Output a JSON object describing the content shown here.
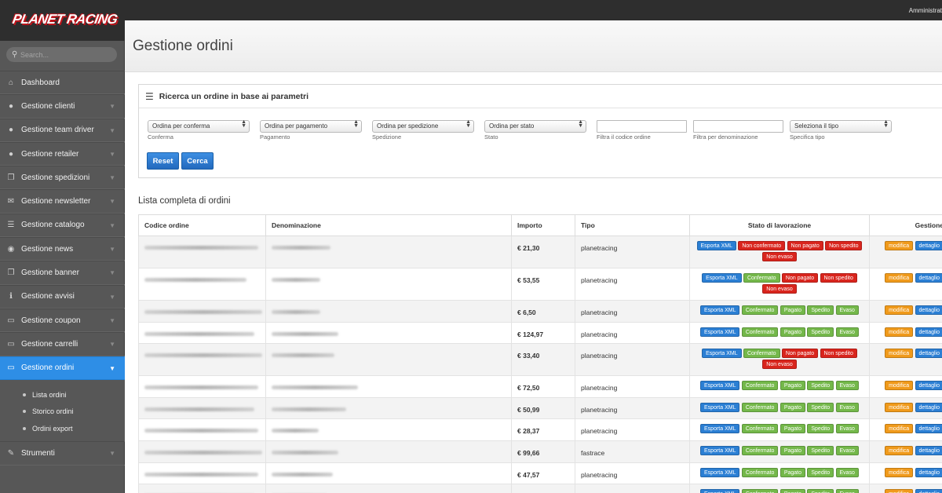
{
  "header": {
    "user_label": "Amministrat"
  },
  "sidebar": {
    "logo_text": "PLANET RACING",
    "search_placeholder": "Search...",
    "items": [
      {
        "label": "Dashboard",
        "icon": "home-icon",
        "glyph": "⌂",
        "has_children": false
      },
      {
        "label": "Gestione clienti",
        "icon": "user-icon",
        "glyph": "●",
        "has_children": true
      },
      {
        "label": "Gestione team driver",
        "icon": "user-icon",
        "glyph": "●",
        "has_children": true
      },
      {
        "label": "Gestione retailer",
        "icon": "user-icon",
        "glyph": "●",
        "has_children": true
      },
      {
        "label": "Gestione spedizioni",
        "icon": "copy-icon",
        "glyph": "❐",
        "has_children": true
      },
      {
        "label": "Gestione newsletter",
        "icon": "envelope-icon",
        "glyph": "✉",
        "has_children": true
      },
      {
        "label": "Gestione catalogo",
        "icon": "list-icon",
        "glyph": "☰",
        "has_children": true
      },
      {
        "label": "Gestione news",
        "icon": "broadcast-icon",
        "glyph": "◉",
        "has_children": true
      },
      {
        "label": "Gestione banner",
        "icon": "copy-icon",
        "glyph": "❐",
        "has_children": true
      },
      {
        "label": "Gestione avvisi",
        "icon": "info-icon",
        "glyph": "ℹ",
        "has_children": true
      },
      {
        "label": "Gestione coupon",
        "icon": "folder-icon",
        "glyph": "▭",
        "has_children": true
      },
      {
        "label": "Gestione carrelli",
        "icon": "folder-icon",
        "glyph": "▭",
        "has_children": true
      },
      {
        "label": "Gestione ordini",
        "icon": "folder-icon",
        "glyph": "▭",
        "has_children": true,
        "active": true
      }
    ],
    "subitems": [
      "Lista ordini",
      "Storico ordini",
      "Ordini export"
    ],
    "tools": {
      "label": "Strumenti",
      "icon": "wrench-icon",
      "glyph": "✎"
    }
  },
  "page": {
    "title": "Gestione ordini"
  },
  "search_panel": {
    "title": "Ricerca un ordine in base ai parametri",
    "filters": [
      {
        "type": "select",
        "value": "Ordina per conferma",
        "label": "Conferma"
      },
      {
        "type": "select",
        "value": "Ordina per pagamento",
        "label": "Pagamento"
      },
      {
        "type": "select",
        "value": "Ordina per spedizione",
        "label": "Spedizione"
      },
      {
        "type": "select",
        "value": "Ordina per stato",
        "label": "Stato"
      },
      {
        "type": "input",
        "value": "",
        "label": "Filtra il codice ordine"
      },
      {
        "type": "input",
        "value": "",
        "label": "Filtra per denominazione"
      },
      {
        "type": "select",
        "value": "Seleziona il tipo",
        "label": "Specifica tipo"
      }
    ],
    "reset_label": "Reset",
    "search_label": "Cerca"
  },
  "list": {
    "title": "Lista completa di ordini",
    "columns": [
      "Codice ordine",
      "Denominazione",
      "Importo",
      "Tipo",
      "Stato di lavorazione",
      "Gestione"
    ],
    "action_labels": [
      "modifica",
      "dettaglio"
    ],
    "rows": [
      {
        "importo": "€ 21,30",
        "tipo": "planetracing",
        "stati": [
          [
            "Esporta XML",
            "blue"
          ],
          [
            "Non confermato",
            "red"
          ],
          [
            "Non pagato",
            "red"
          ],
          [
            "Non spedito",
            "red"
          ],
          [
            "Non evaso",
            "red"
          ]
        ]
      },
      {
        "importo": "€ 53,55",
        "tipo": "planetracing",
        "stati": [
          [
            "Esporta XML",
            "blue"
          ],
          [
            "Confermato",
            "green"
          ],
          [
            "Non pagato",
            "red"
          ],
          [
            "Non spedito",
            "red"
          ],
          [
            "Non evaso",
            "red"
          ]
        ]
      },
      {
        "importo": "€ 6,50",
        "tipo": "planetracing",
        "stati": [
          [
            "Esporta XML",
            "blue"
          ],
          [
            "Confermato",
            "green"
          ],
          [
            "Pagato",
            "green"
          ],
          [
            "Spedito",
            "green"
          ],
          [
            "Evaso",
            "green"
          ]
        ]
      },
      {
        "importo": "€ 124,97",
        "tipo": "planetracing",
        "stati": [
          [
            "Esporta XML",
            "blue"
          ],
          [
            "Confermato",
            "green"
          ],
          [
            "Pagato",
            "green"
          ],
          [
            "Spedito",
            "green"
          ],
          [
            "Evaso",
            "green"
          ]
        ]
      },
      {
        "importo": "€ 33,40",
        "tipo": "planetracing",
        "stati": [
          [
            "Esporta XML",
            "blue"
          ],
          [
            "Confermato",
            "green"
          ],
          [
            "Non pagato",
            "red"
          ],
          [
            "Non spedito",
            "red"
          ],
          [
            "Non evaso",
            "red"
          ]
        ]
      },
      {
        "importo": "€ 72,50",
        "tipo": "planetracing",
        "stati": [
          [
            "Esporta XML",
            "blue"
          ],
          [
            "Confermato",
            "green"
          ],
          [
            "Pagato",
            "green"
          ],
          [
            "Spedito",
            "green"
          ],
          [
            "Evaso",
            "green"
          ]
        ]
      },
      {
        "importo": "€ 50,99",
        "tipo": "planetracing",
        "stati": [
          [
            "Esporta XML",
            "blue"
          ],
          [
            "Confermato",
            "green"
          ],
          [
            "Pagato",
            "green"
          ],
          [
            "Spedito",
            "green"
          ],
          [
            "Evaso",
            "green"
          ]
        ]
      },
      {
        "importo": "€ 28,37",
        "tipo": "planetracing",
        "stati": [
          [
            "Esporta XML",
            "blue"
          ],
          [
            "Confermato",
            "green"
          ],
          [
            "Pagato",
            "green"
          ],
          [
            "Spedito",
            "green"
          ],
          [
            "Evaso",
            "green"
          ]
        ]
      },
      {
        "importo": "€ 99,66",
        "tipo": "fastrace",
        "stati": [
          [
            "Esporta XML",
            "blue"
          ],
          [
            "Confermato",
            "green"
          ],
          [
            "Pagato",
            "green"
          ],
          [
            "Spedito",
            "green"
          ],
          [
            "Evaso",
            "green"
          ]
        ]
      },
      {
        "importo": "€ 47,57",
        "tipo": "planetracing",
        "stati": [
          [
            "Esporta XML",
            "blue"
          ],
          [
            "Confermato",
            "green"
          ],
          [
            "Pagato",
            "green"
          ],
          [
            "Spedito",
            "green"
          ],
          [
            "Evaso",
            "green"
          ]
        ]
      },
      {
        "importo": "",
        "tipo": "",
        "stati": [
          [
            "Esporta XML",
            "blue"
          ],
          [
            "Confermato",
            "green"
          ],
          [
            "Pagato",
            "green"
          ],
          [
            "Spedito",
            "green"
          ],
          [
            "Evaso",
            "green"
          ]
        ]
      }
    ]
  },
  "colors": {
    "accent": "#2e8ee6",
    "danger": "#d9251d",
    "success": "#74b84a",
    "warning": "#f09a1b",
    "sidebar": "#575757"
  }
}
